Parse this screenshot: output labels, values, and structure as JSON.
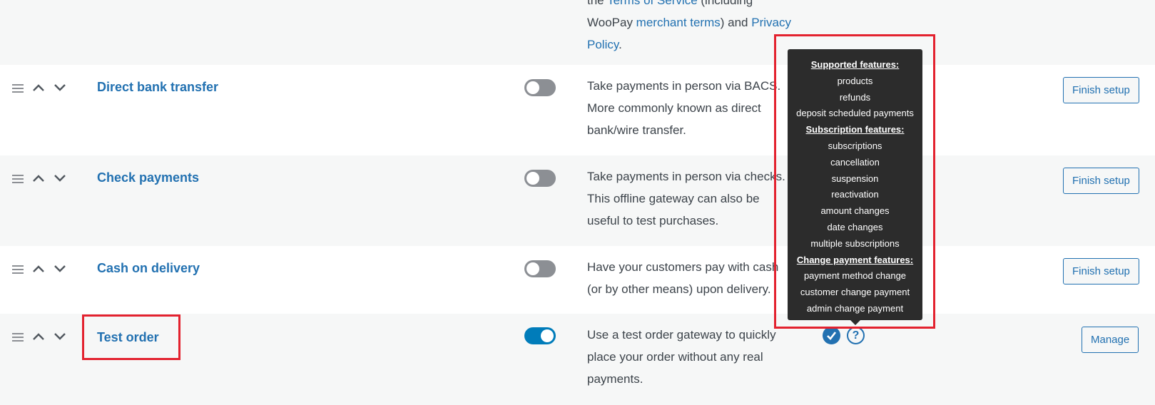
{
  "top_row": {
    "line1_prefix": "the ",
    "line1_link": "Terms of Service",
    "line1_suffix": " (including",
    "line2_prefix": "WooPay ",
    "line2_link1": "merchant terms",
    "line2_mid": ") and ",
    "line2_link2": "Privacy",
    "line3_link": "Policy",
    "line3_suffix": "."
  },
  "gateways": [
    {
      "name": "Direct bank transfer",
      "enabled": false,
      "description": "Take payments in person via BACS. More commonly known as direct bank/wire transfer.",
      "action_label": "Finish setup"
    },
    {
      "name": "Check payments",
      "enabled": false,
      "description": "Take payments in person via checks. This offline gateway can also be useful to test purchases.",
      "action_label": "Finish setup"
    },
    {
      "name": "Cash on delivery",
      "enabled": false,
      "description": "Have your customers pay with cash (or by other means) upon delivery.",
      "action_label": "Finish setup"
    },
    {
      "name": "Test order",
      "enabled": true,
      "description": "Use a test order gateway to quickly place your order without any real payments.",
      "action_label": "Manage"
    }
  ],
  "tooltip": {
    "lines": [
      {
        "text": "Supported features:",
        "heading": true
      },
      {
        "text": "products",
        "heading": false
      },
      {
        "text": "refunds",
        "heading": false
      },
      {
        "text": "deposit scheduled payments",
        "heading": false
      },
      {
        "text": "Subscription features:",
        "heading": true
      },
      {
        "text": "subscriptions",
        "heading": false
      },
      {
        "text": "cancellation",
        "heading": false
      },
      {
        "text": "suspension",
        "heading": false
      },
      {
        "text": "reactivation",
        "heading": false
      },
      {
        "text": "amount changes",
        "heading": false
      },
      {
        "text": "date changes",
        "heading": false
      },
      {
        "text": "multiple subscriptions",
        "heading": false
      },
      {
        "text": "Change payment features:",
        "heading": true
      },
      {
        "text": "payment method change",
        "heading": false
      },
      {
        "text": "customer change payment",
        "heading": false
      },
      {
        "text": "admin change payment",
        "heading": false
      }
    ]
  },
  "icons": {
    "help": "?",
    "drag": "drag-handle-icon",
    "up": "chevron-up-icon",
    "down": "chevron-down-icon",
    "check": "checkmark-icon"
  },
  "colors": {
    "accent": "#2271b1",
    "toggle_on": "#007cba",
    "toggle_off": "#8c8f94",
    "highlight": "#e3222f",
    "tooltip_bg": "#2c2c2c"
  }
}
